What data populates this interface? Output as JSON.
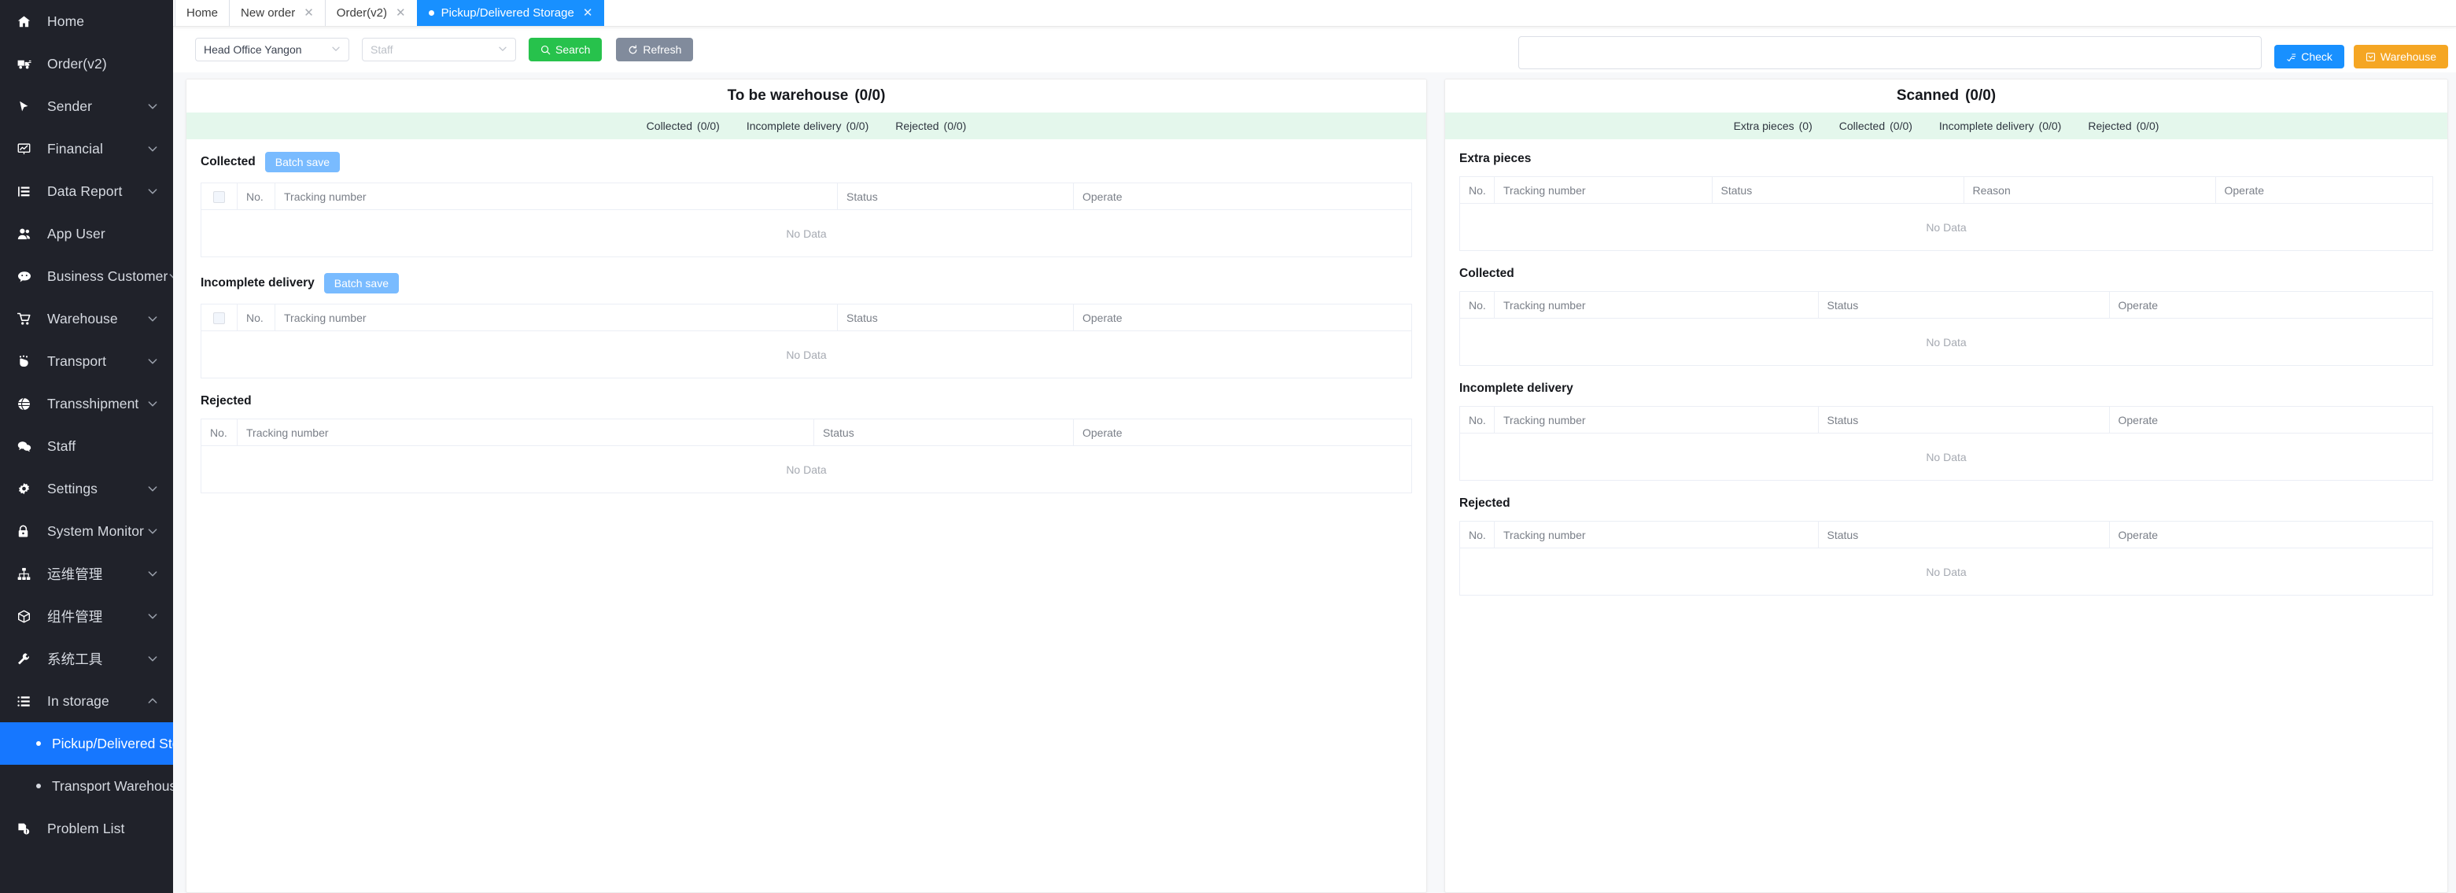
{
  "sidebar": {
    "items": [
      {
        "label": "Home",
        "icon": "home-icon",
        "expandable": false
      },
      {
        "label": "Order(v2)",
        "icon": "truck-icon",
        "expandable": false
      },
      {
        "label": "Sender",
        "icon": "cursor-icon",
        "expandable": true
      },
      {
        "label": "Financial",
        "icon": "chart-board-icon",
        "expandable": true
      },
      {
        "label": "Data Report",
        "icon": "list-tree-icon",
        "expandable": true
      },
      {
        "label": "App User",
        "icon": "users-icon",
        "expandable": false
      },
      {
        "label": "Business Customer",
        "icon": "chat-icon",
        "expandable": true
      },
      {
        "label": "Warehouse",
        "icon": "cart-icon",
        "expandable": true
      },
      {
        "label": "Transport",
        "icon": "hand-icon",
        "expandable": true
      },
      {
        "label": "Transshipment",
        "icon": "globe-icon",
        "expandable": true
      },
      {
        "label": "Staff",
        "icon": "comment-dots-icon",
        "expandable": false
      },
      {
        "label": "Settings",
        "icon": "gear-icon",
        "expandable": true
      },
      {
        "label": "System Monitor",
        "icon": "lock-icon",
        "expandable": true
      },
      {
        "label": "运维管理",
        "icon": "sitemap-icon",
        "expandable": true
      },
      {
        "label": "组件管理",
        "icon": "cube-icon",
        "expandable": true
      },
      {
        "label": "系统工具",
        "icon": "tool-icon",
        "expandable": true
      },
      {
        "label": "In storage",
        "icon": "storage-list-icon",
        "expandable": true,
        "expanded": true
      }
    ],
    "in_storage_children": [
      {
        "label": "Pickup/Delivered Storage",
        "active": true
      },
      {
        "label": "Transport Warehoused",
        "active": false
      }
    ],
    "problem_list": {
      "label": "Problem List",
      "icon": "problem-doc-icon"
    },
    "active_color": "#1677ff"
  },
  "tabs": [
    {
      "label": "Home",
      "closable": false,
      "active": false
    },
    {
      "label": "New order",
      "closable": true,
      "active": false
    },
    {
      "label": "Order(v2)",
      "closable": true,
      "active": false
    },
    {
      "label": "Pickup/Delivered Storage",
      "closable": true,
      "active": true
    }
  ],
  "toolbar": {
    "office_select": {
      "value": "Head Office Yangon",
      "icon": "chevron-down-icon"
    },
    "staff_select": {
      "value": "",
      "placeholder": "Staff",
      "icon": "chevron-down-icon"
    },
    "search_button": {
      "label": "Search",
      "icon": "search-icon",
      "color": "#27c24c"
    },
    "refresh_button": {
      "label": "Refresh",
      "icon": "refresh-icon",
      "color": "#818b9c"
    },
    "scan_input": {
      "value": "",
      "placeholder": ""
    },
    "check_button": {
      "label": "Check",
      "icon": "check-scan-icon",
      "color": "#1890ff"
    },
    "warehouse_button": {
      "label": "Warehouse",
      "icon": "inbox-icon",
      "color": "#f5a623"
    }
  },
  "left_panel": {
    "title": "To be warehouse",
    "count": "(0/0)",
    "summary": [
      {
        "label": "Collected",
        "count": "(0/0)"
      },
      {
        "label": "Incomplete delivery",
        "count": "(0/0)"
      },
      {
        "label": "Rejected",
        "count": "(0/0)"
      }
    ],
    "sections": [
      {
        "title": "Collected",
        "batch_save": "Batch save",
        "has_checkbox": true,
        "columns": [
          "No.",
          "Tracking number",
          "Status",
          "Operate"
        ],
        "rows": [],
        "empty_text": "No Data"
      },
      {
        "title": "Incomplete delivery",
        "batch_save": "Batch save",
        "has_checkbox": true,
        "columns": [
          "No.",
          "Tracking number",
          "Status",
          "Operate"
        ],
        "rows": [],
        "empty_text": "No Data"
      },
      {
        "title": "Rejected",
        "batch_save": null,
        "has_checkbox": false,
        "columns": [
          "No.",
          "Tracking number",
          "Status",
          "Operate"
        ],
        "rows": [],
        "empty_text": "No Data"
      }
    ]
  },
  "right_panel": {
    "title": "Scanned",
    "count": "(0/0)",
    "summary": [
      {
        "label": "Extra pieces",
        "count": "(0)"
      },
      {
        "label": "Collected",
        "count": "(0/0)"
      },
      {
        "label": "Incomplete delivery",
        "count": "(0/0)"
      },
      {
        "label": "Rejected",
        "count": "(0/0)"
      }
    ],
    "sections": [
      {
        "title": "Extra pieces",
        "columns": [
          "No.",
          "Tracking number",
          "Status",
          "Reason",
          "Operate"
        ],
        "rows": [],
        "empty_text": "No Data"
      },
      {
        "title": "Collected",
        "columns": [
          "No.",
          "Tracking number",
          "Status",
          "Operate"
        ],
        "rows": [],
        "empty_text": "No Data"
      },
      {
        "title": "Incomplete delivery",
        "columns": [
          "No.",
          "Tracking number",
          "Status",
          "Operate"
        ],
        "rows": [],
        "empty_text": "No Data"
      },
      {
        "title": "Rejected",
        "columns": [
          "No.",
          "Tracking number",
          "Status",
          "Operate"
        ],
        "rows": [],
        "empty_text": "No Data"
      }
    ]
  }
}
